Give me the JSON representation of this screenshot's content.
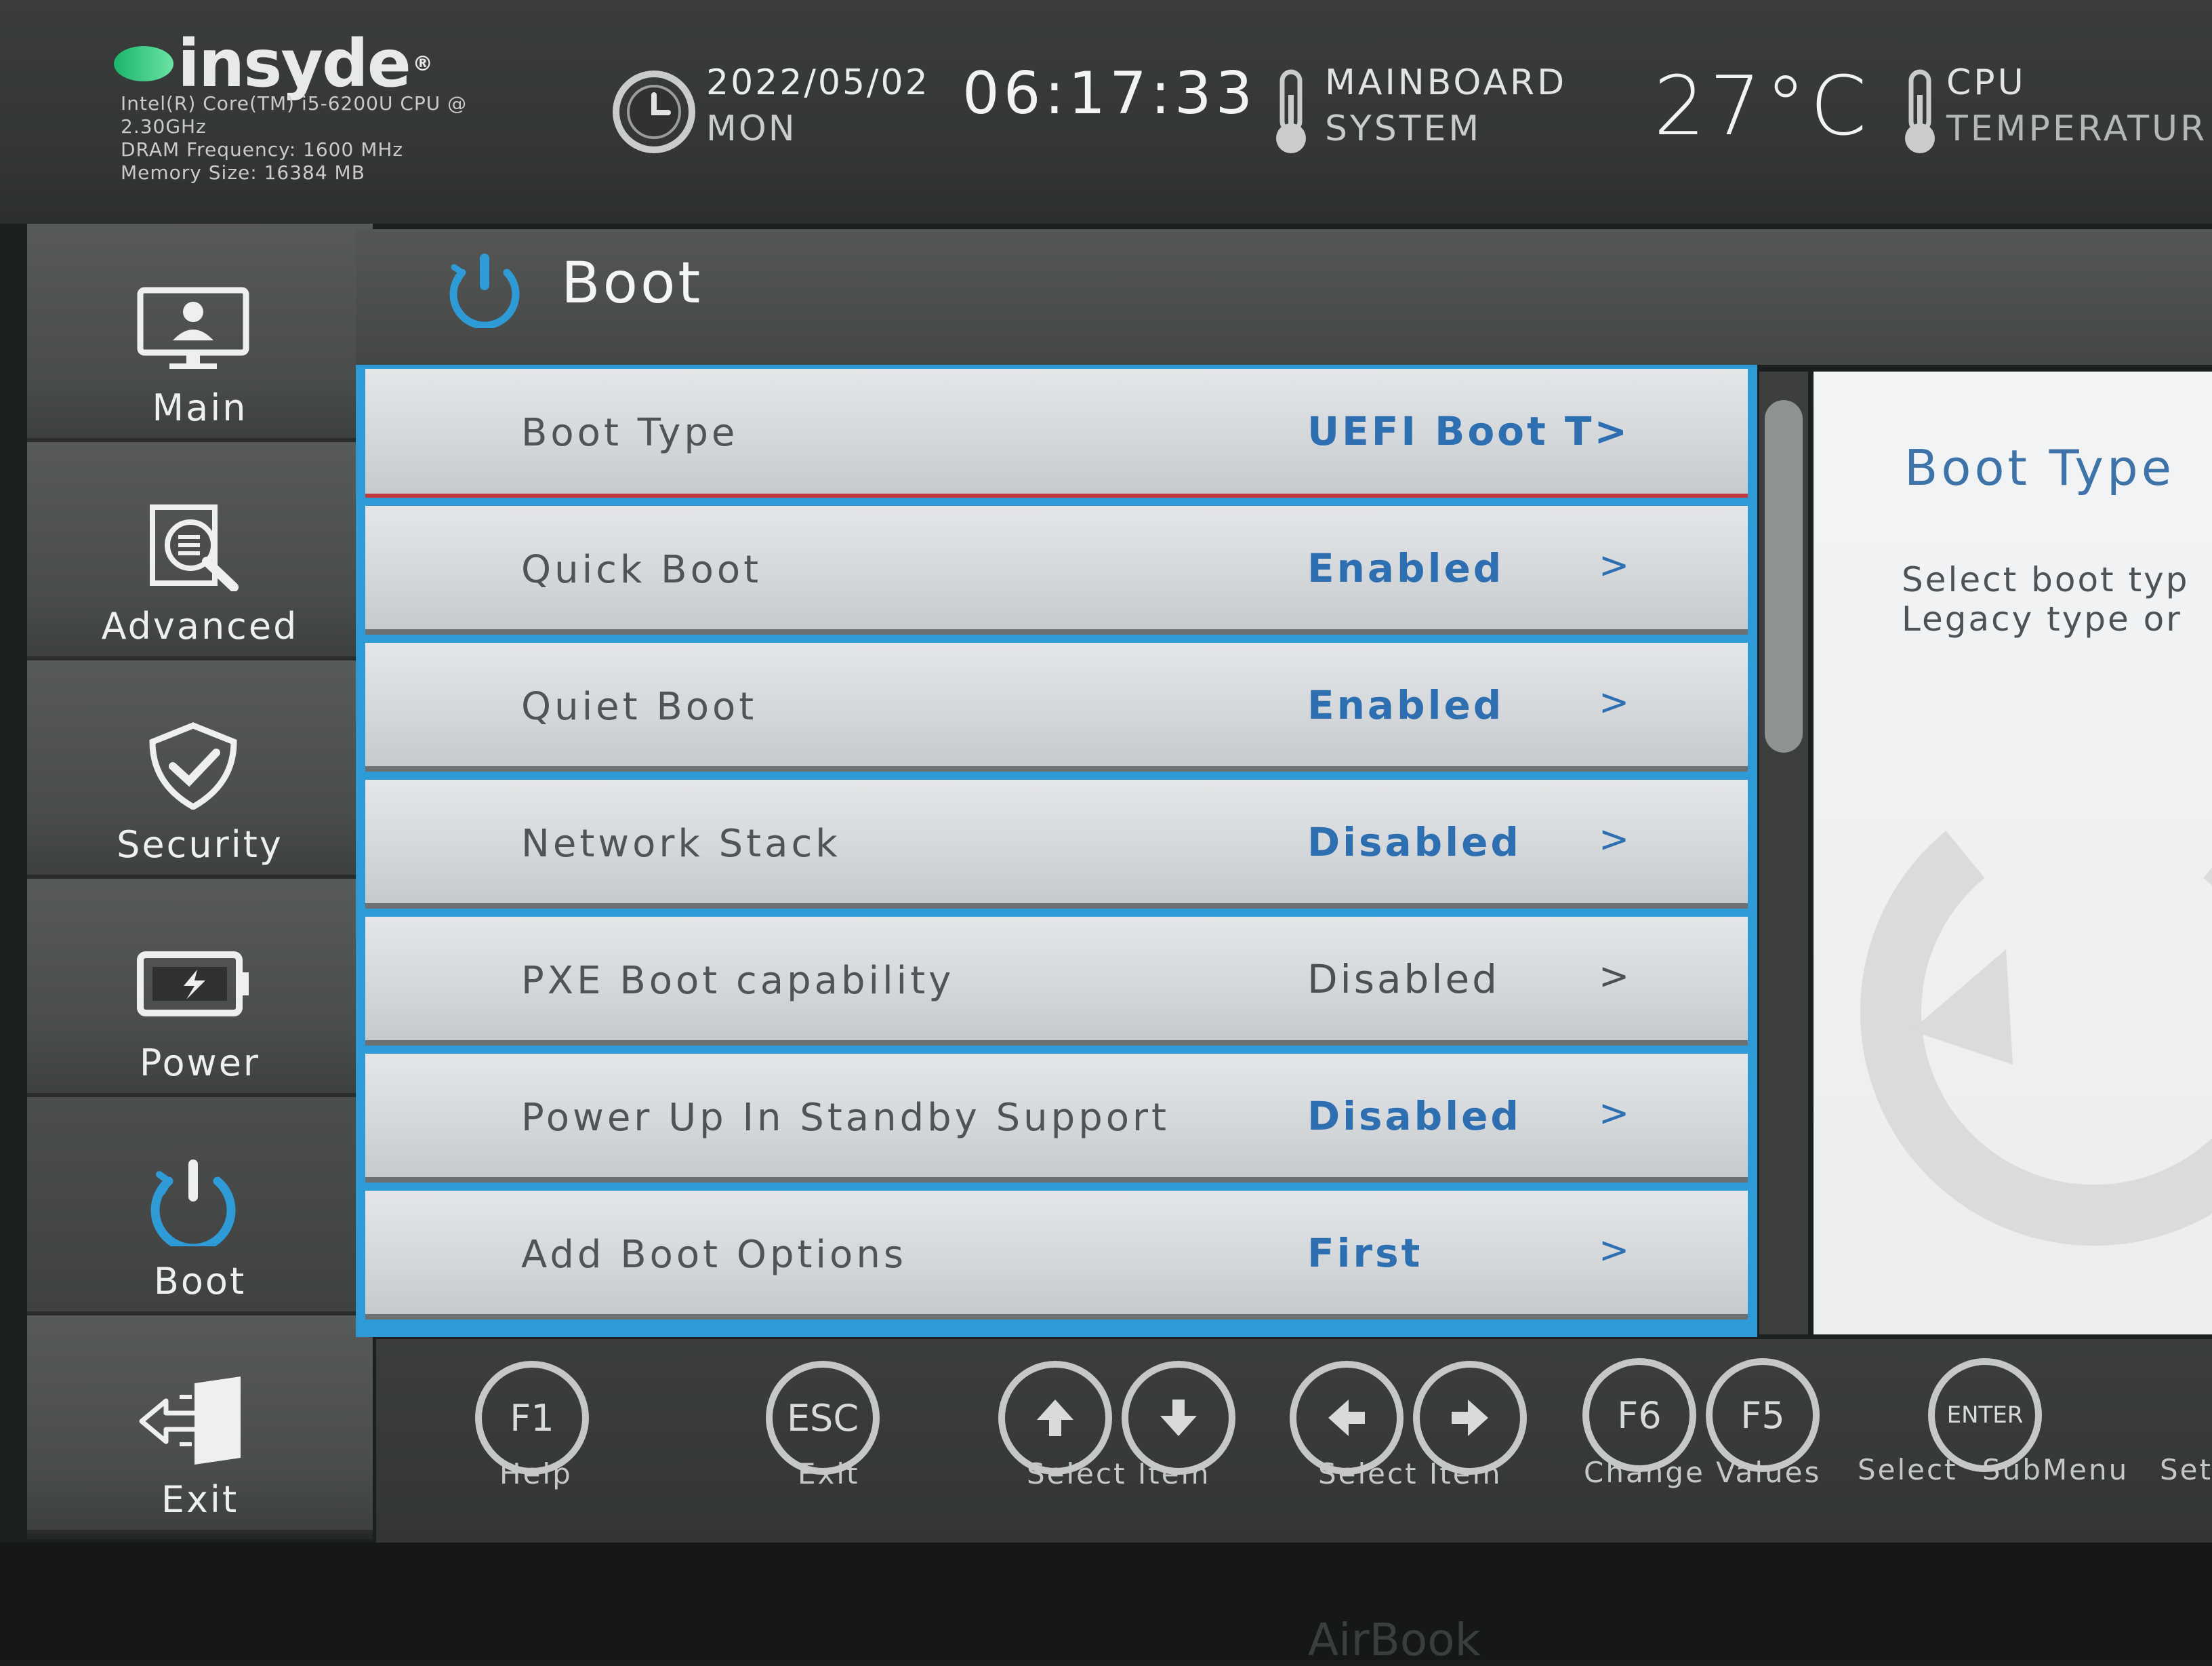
{
  "header": {
    "logo": "insyde",
    "cpu_line1": "Intel(R) Core(TM) i5-6200U CPU @",
    "cpu_line2": "2.30GHz",
    "dram": "DRAM Frequency: 1600 MHz",
    "memory": "Memory Size: 16384 MB",
    "date": "2022/05/02",
    "day": "MON",
    "time": "06:17:33",
    "mainboard_label_1": "MAINBOARD",
    "mainboard_label_2": "SYSTEM",
    "temperature": "27°C",
    "cpu_label_1": "CPU",
    "cpu_label_2": "TEMPERATUR"
  },
  "sidebar": {
    "items": [
      {
        "label": "Main",
        "icon": "monitor-user-icon"
      },
      {
        "label": "Advanced",
        "icon": "advanced-search-icon"
      },
      {
        "label": "Security",
        "icon": "shield-check-icon"
      },
      {
        "label": "Power",
        "icon": "battery-icon"
      },
      {
        "label": "Boot",
        "icon": "power-icon",
        "active": true
      },
      {
        "label": "Exit",
        "icon": "exit-door-icon"
      }
    ]
  },
  "page": {
    "title": "Boot",
    "icon": "power-icon"
  },
  "settings": [
    {
      "name": "Boot Type",
      "value": "UEFI Boot T>",
      "selected": true
    },
    {
      "name": "Quick Boot",
      "value": "Enabled",
      "chevron": ">"
    },
    {
      "name": "Quiet Boot",
      "value": "Enabled",
      "chevron": ">"
    },
    {
      "name": "Network Stack",
      "value": "Disabled",
      "chevron": ">"
    },
    {
      "name": "PXE Boot capability",
      "value": "Disabled",
      "chevron": ">"
    },
    {
      "name": "Power Up In Standby Support",
      "value": "Disabled",
      "chevron": ">"
    },
    {
      "name": "Add Boot Options",
      "value": "First",
      "chevron": ">"
    }
  ],
  "help": {
    "title": "Boot Type",
    "line1": "Select boot typ",
    "line2": "Legacy type or"
  },
  "footer": {
    "keys": {
      "f1": "F1",
      "esc": "ESC",
      "f6": "F6",
      "f5": "F5",
      "enter": "ENTER"
    },
    "labels": {
      "help": "Help",
      "exit": "Exit",
      "select_item_vertical": "Select Item",
      "select_item_horizontal": "Select Item",
      "change_values": "Change Values",
      "select": "Select",
      "submenu": "SubMenu",
      "setup": "Set"
    }
  },
  "bezel": {
    "brand": "AirBook"
  },
  "colors": {
    "accent_blue": "#2e9bd6",
    "value_blue": "#2d6fb0",
    "selected_border": "#c43a3a"
  }
}
